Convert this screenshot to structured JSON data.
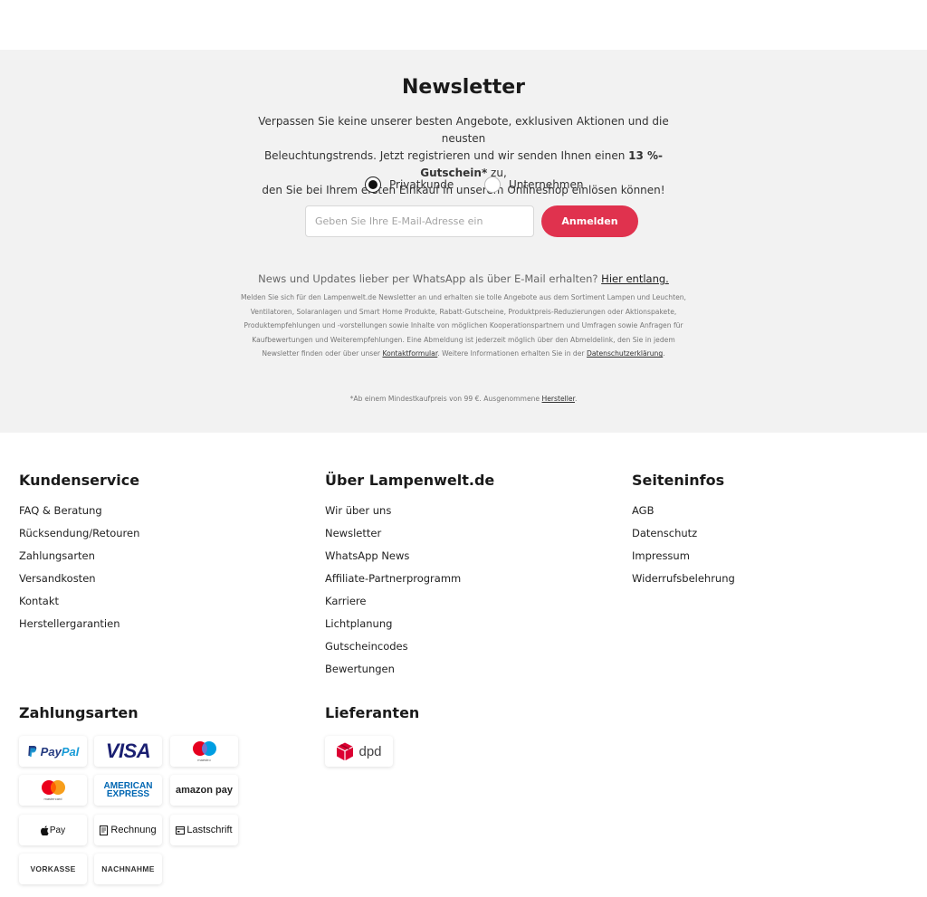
{
  "newsletter": {
    "title": "Newsletter",
    "intro_line1": "Verpassen Sie keine unserer besten Angebote, exklusiven Aktionen und die neusten",
    "intro_line2_pre": "Beleuchtungstrends. Jetzt registrieren und wir senden Ihnen einen",
    "intro_line2_bold": "13 %-Gutschein*",
    "intro_line2_post": "zu,",
    "intro_line3": "den Sie bei Ihrem ersten Einkauf in unserem Onlineshop einlösen können!",
    "radio_private": "Privatkunde",
    "radio_company": "Unternehmen",
    "selected": "Privatkunde",
    "email_placeholder": "Geben Sie Ihre E-Mail-Adresse ein",
    "submit_label": "Anmelden",
    "whatsapp_text": "News und Updates lieber per WhatsApp als über E-Mail erhalten?",
    "whatsapp_link": "Hier entlang.",
    "legal_text_1": "Melden Sie sich für den Lampenwelt.de Newsletter an und erhalten sie tolle Angebote aus dem Sortiment Lampen und Leuchten, Ventilatoren, Solaranlagen und Smart Home Produkte, Rabatt-Gutscheine, Produktpreis-Reduzierungen oder Aktionspakete, Produktempfehlungen und -vorstellungen sowie Inhalte von möglichen Kooperationspartnern und Umfragen sowie Anfragen für Kaufbewertungen und Weiterempfehlungen. Eine Abmeldung ist jederzeit möglich über den Abmeldelink, den Sie in jedem Newsletter finden oder über unser",
    "legal_link_1": "Kontaktformular",
    "legal_text_2": ". Weitere Informationen erhalten Sie in der",
    "legal_link_2": "Datenschutzerklärung",
    "legal_text_3": ".",
    "footnote_text": "*Ab einem Mindestkaufpreis von 99 €. Ausgenommene",
    "footnote_link": "Hersteller",
    "footnote_end": "."
  },
  "footer": {
    "kundenservice": {
      "title": "Kundenservice",
      "links": [
        "FAQ & Beratung",
        "Rücksendung/Retouren",
        "Zahlungsarten",
        "Versandkosten",
        "Kontakt",
        "Herstellergarantien"
      ]
    },
    "ueber": {
      "title": "Über Lampenwelt.de",
      "links": [
        "Wir über uns",
        "Newsletter",
        "WhatsApp News",
        "Affiliate-Partnerprogramm",
        "Karriere",
        "Lichtplanung",
        "Gutscheincodes",
        "Bewertungen"
      ]
    },
    "seiteninfos": {
      "title": "Seiteninfos",
      "links": [
        "AGB",
        "Datenschutz",
        "Impressum",
        "Widerrufsbelehrung"
      ]
    },
    "zahlungsarten": {
      "title": "Zahlungsarten",
      "paypal_a": "Pay",
      "paypal_b": "Pal",
      "visa": "VISA",
      "maestro": "maestro",
      "mastercard": "mastercard",
      "amex_1": "AMERICAN",
      "amex_2": "EXPRESS",
      "amazon": "amazon pay",
      "applepay": "Pay",
      "rechnung": "Rechnung",
      "lastschrift": "Lastschrift",
      "vorkasse": "VORKASSE",
      "nachnahme": "NACHNAHME"
    },
    "lieferanten": {
      "title": "Lieferanten",
      "dpd": "dpd"
    }
  },
  "colors": {
    "accent": "#e0324e",
    "newsletter_bg": "#f2f2f2"
  }
}
